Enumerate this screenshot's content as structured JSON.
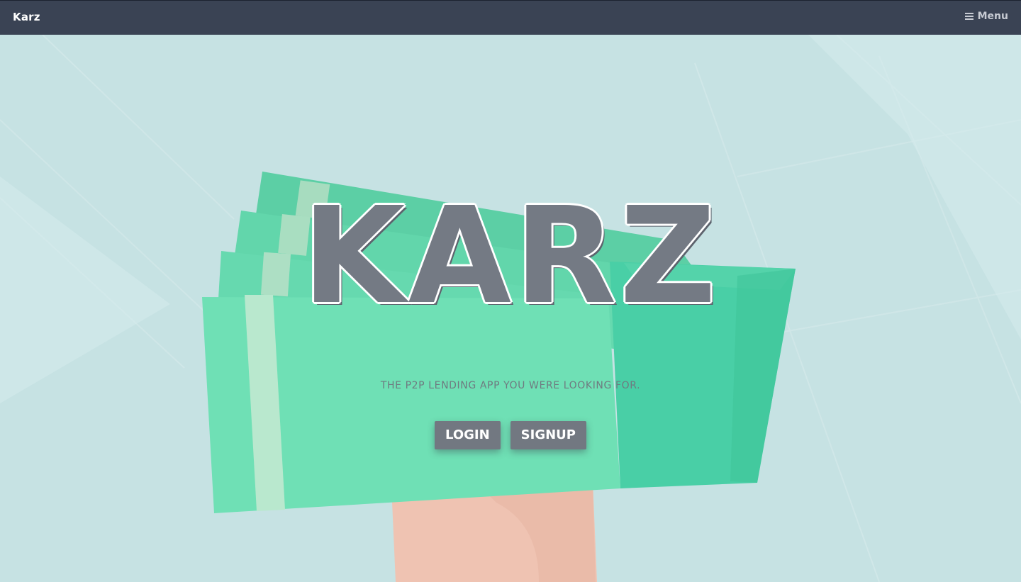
{
  "navbar": {
    "brand": "Karz",
    "menu_label": "Menu",
    "menu_icon": "hamburger-icon"
  },
  "hero": {
    "title": "KARZ",
    "tagline": "THE P2P LENDING APP YOU WERE LOOKING FOR.",
    "login_label": "LOGIN",
    "signup_label": "SIGNUP",
    "illustration": "hand-holding-banknotes"
  },
  "colors": {
    "navbar_bg": "#3a4354",
    "hero_bg": "#c6e2e3",
    "banknote": "#6fe0b5",
    "banknote_dark": "#4bd1a8",
    "hand": "#efc3b2",
    "title": "#747a84",
    "button_bg": "#727881"
  }
}
